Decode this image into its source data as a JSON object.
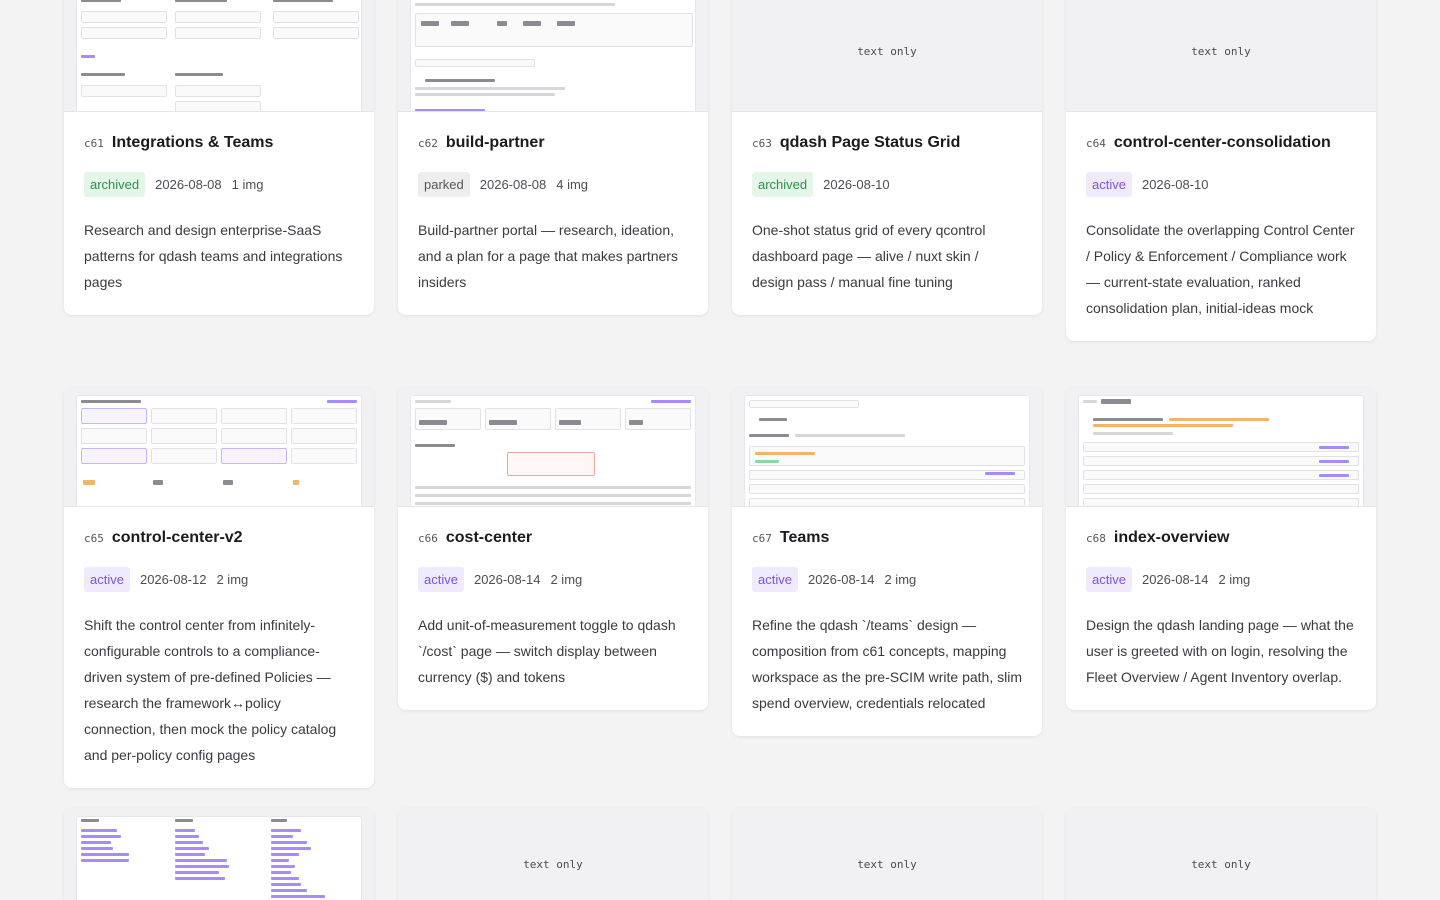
{
  "text_only_label": "text only",
  "cards": [
    {
      "code": "c61",
      "title": "Integrations & Teams",
      "status": "archived",
      "date": "2026-08-08",
      "images": "1 img",
      "description": "Research and design enterprise-SaaS patterns for qdash teams and integrations pages"
    },
    {
      "code": "c62",
      "title": "build-partner",
      "status": "parked",
      "date": "2026-08-08",
      "images": "4 img",
      "description": "Build-partner portal — research, ideation, and a plan for a page that makes partners insiders"
    },
    {
      "code": "c63",
      "title": "qdash Page Status Grid",
      "status": "archived",
      "date": "2026-08-10",
      "images": "",
      "description": "One-shot status grid of every qcontrol dashboard page — alive / nuxt skin / design pass / manual fine tuning"
    },
    {
      "code": "c64",
      "title": "control-center-consolidation",
      "status": "active",
      "date": "2026-08-10",
      "images": "",
      "description": "Consolidate the overlapping Control Center / Policy & Enforcement / Compliance work — current-state evaluation, ranked consolidation plan, initial-ideas mock"
    },
    {
      "code": "c65",
      "title": "control-center-v2",
      "status": "active",
      "date": "2026-08-12",
      "images": "2 img",
      "description": "Shift the control center from infinitely-configurable controls to a compliance-driven system of pre-defined Policies — research the framework↔policy connection, then mock the policy catalog and per-policy config pages"
    },
    {
      "code": "c66",
      "title": "cost-center",
      "status": "active",
      "date": "2026-08-14",
      "images": "2 img",
      "description": "Add unit-of-measurement toggle to qdash `/cost` page — switch display between currency ($) and tokens"
    },
    {
      "code": "c67",
      "title": "Teams",
      "status": "active",
      "date": "2026-08-14",
      "images": "2 img",
      "description": "Refine the qdash `/teams` design — composition from c61 concepts, mapping workspace as the pre-SCIM write path, slim spend overview, credentials relocated"
    },
    {
      "code": "c68",
      "title": "index-overview",
      "status": "active",
      "date": "2026-08-14",
      "images": "2 img",
      "description": "Design the qdash landing page — what the user is greeted with on login, resolving the Fleet Overview / Agent Inventory overlap."
    }
  ],
  "colors": {
    "archived": "#2f8f4e",
    "parked": "#55555a",
    "active": "#7c55d8"
  }
}
